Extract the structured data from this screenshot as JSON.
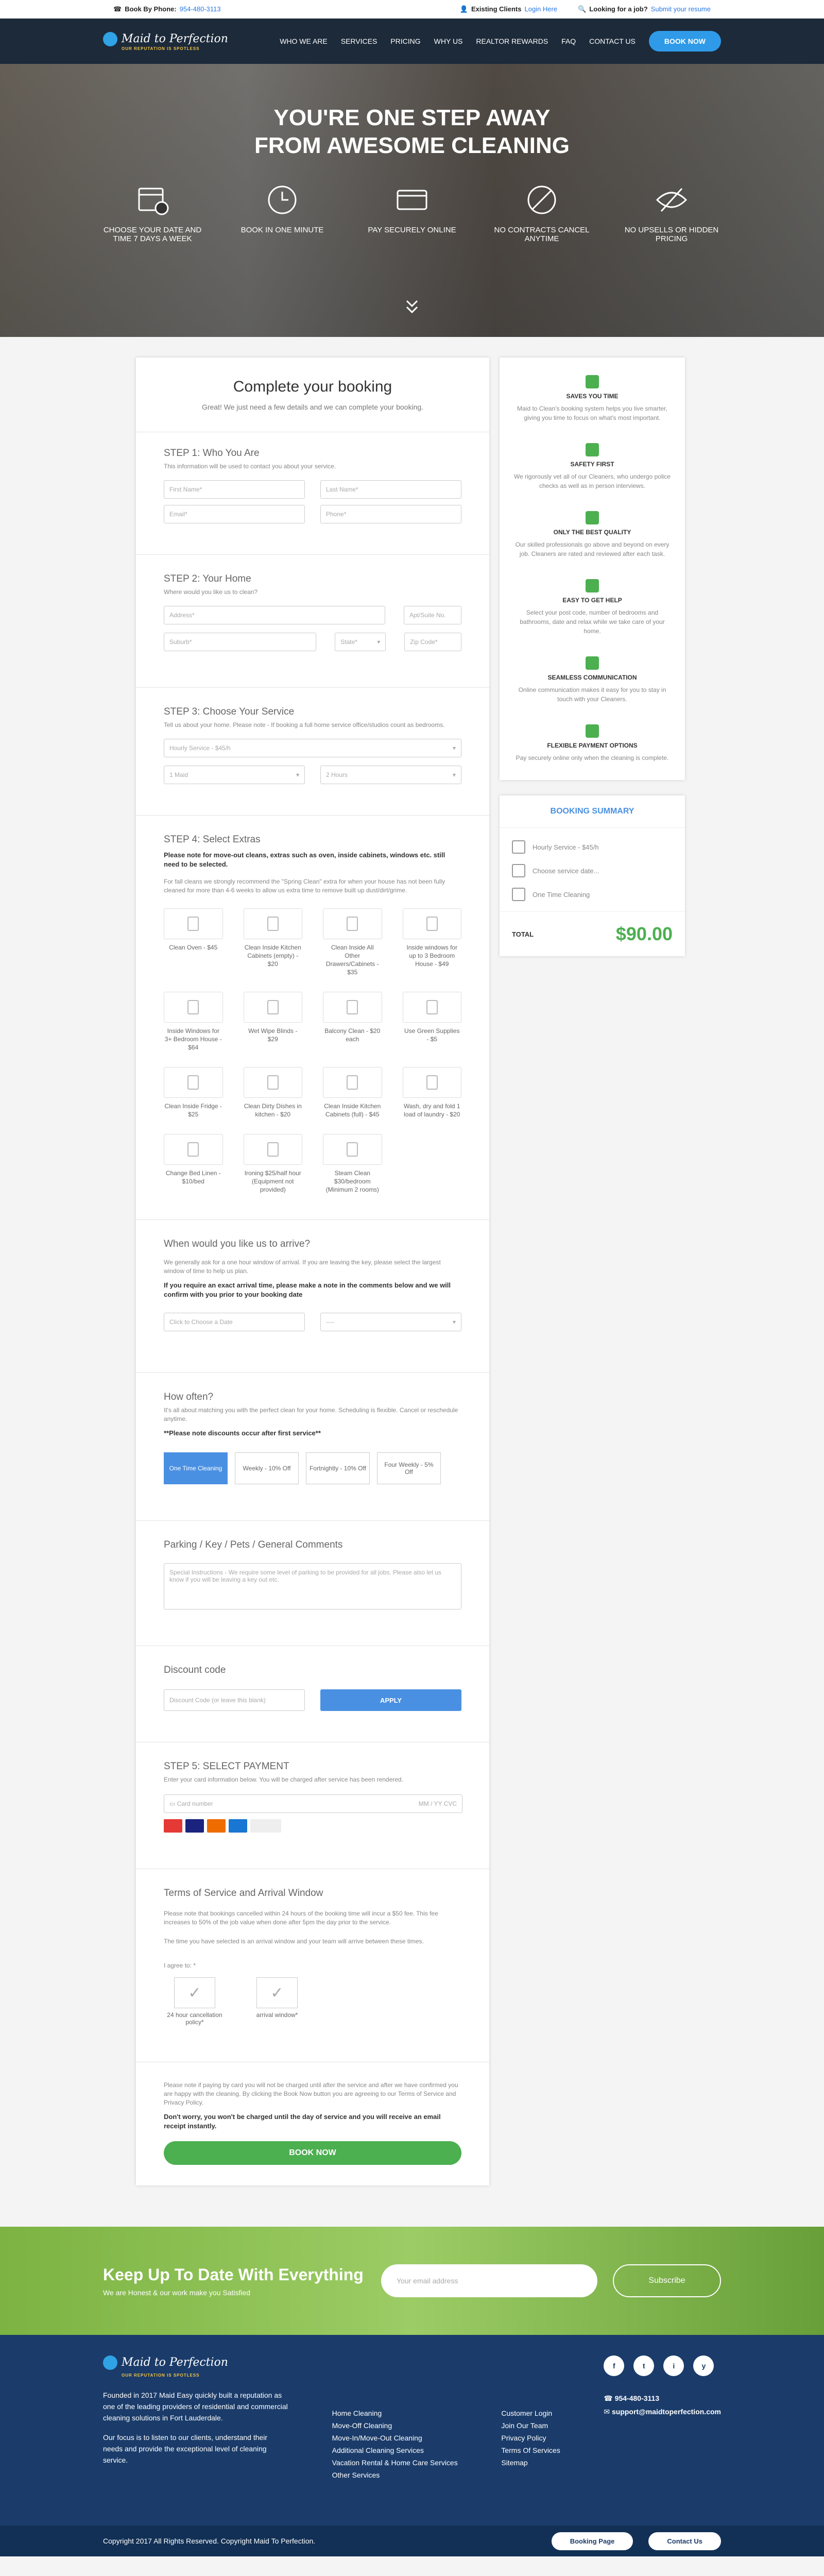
{
  "topbar": {
    "phone_label": "Book By Phone:",
    "phone": "954-480-3113",
    "existing": "Existing Clients",
    "login": "Login Here",
    "job": "Looking for a job?",
    "apply": "Submit your resume"
  },
  "nav": {
    "logo": "Maid to Perfection",
    "tagline": "OUR REPUTATION IS SPOTLESS",
    "items": [
      "WHO WE ARE",
      "SERVICES",
      "PRICING",
      "WHY US",
      "REALTOR REWARDS",
      "FAQ",
      "CONTACT US"
    ],
    "book": "BOOK NOW"
  },
  "hero": {
    "title1": "YOU'RE ONE STEP AWAY",
    "title2": "FROM AWESOME CLEANING",
    "features": [
      "CHOOSE YOUR DATE AND TIME 7 DAYS A WEEK",
      "BOOK IN ONE MINUTE",
      "PAY SECURELY ONLINE",
      "NO CONTRACTS CANCEL ANYTIME",
      "NO UPSELLS OR HIDDEN PRICING"
    ]
  },
  "booking": {
    "title": "Complete your booking",
    "subtitle": "Great! We just need a few details and we can complete your booking.",
    "step1": {
      "title": "STEP 1: Who You Are",
      "note": "This information will be used to contact you about your service.",
      "first": "First Name*",
      "last": "Last Name*",
      "email": "Email*",
      "phone": "Phone*"
    },
    "step2": {
      "title": "STEP 2: Your Home",
      "note": "Where would you like us to clean?",
      "address": "Address*",
      "suite": "Apt/Suite No.",
      "suburb": "Suburb*",
      "state": "State*",
      "zip": "Zip Code*"
    },
    "step3": {
      "title": "STEP 3: Choose Your Service",
      "note": "Tell us about your home. Please note - If booking a full home service office/studios count as bedrooms.",
      "service": "Hourly Service - $45/h",
      "maid": "1 Maid",
      "hours": "2 Hours"
    },
    "step4": {
      "title": "STEP 4: Select Extras",
      "bold": "Please note for move-out cleans, extras such as oven, inside cabinets, windows etc. still need to be selected.",
      "note": "For fall cleans we strongly recommend the \"Spring Clean\" extra for when your house has not been fully cleaned for more than 4-6 weeks to allow us extra time to remove built up dust/dirt/grime.",
      "extras": [
        "Clean Oven - $45",
        "Clean Inside Kitchen Cabinets (empty) - $20",
        "Clean Inside All Other Drawers/Cabinets - $35",
        "Inside windows for up to 3 Bedroom House - $49",
        "Inside Windows for 3+ Bedroom House - $64",
        "Wet Wipe Blinds - $29",
        "Balcony Clean - $20 each",
        "Use Green Supplies - $5",
        "Clean Inside Fridge - $25",
        "Clean Dirty Dishes in kitchen - $20",
        "Clean Inside Kitchen Cabinets (full) - $45",
        "Wash, dry and fold 1 load of laundry - $20",
        "Change Bed Linen - $10/bed",
        "Ironing $25/half hour (Equipment not provided)",
        "Steam Clean $30/bedroom (Minimum 2 rooms)"
      ]
    },
    "arrive": {
      "title": "When would you like us to arrive?",
      "note": "We generally ask for a one hour window of arrival. If you are leaving the key, please select the largest window of time to help us plan.",
      "bold": "If you require an exact arrival time, please make a note in the comments below and we will confirm with you prior to your booking date",
      "date": "Click to Choose a Date",
      "time": "----"
    },
    "often": {
      "title": "How often?",
      "note": "It's all about matching you with the perfect clean for your home. Scheduling is flexible. Cancel or reschedule anytime.",
      "bold": "**Please note discounts occur after first service**",
      "options": [
        "One Time Cleaning",
        "Weekly - 10% Off",
        "Fortnightly - 10% Off",
        "Four Weekly - 5% Off"
      ]
    },
    "comments": {
      "title": "Parking / Key / Pets / General Comments",
      "placeholder": "Special Instructions - We require some level of parking to be provided for all jobs. Please also let us know if you will be leaving a key out etc."
    },
    "discount": {
      "title": "Discount code",
      "placeholder": "Discount Code (or leave this blank)",
      "apply": "APPLY"
    },
    "step5": {
      "title": "STEP 5: SELECT PAYMENT",
      "note": "Enter your card information below. You will be charged after service has been rendered.",
      "card": "Card number",
      "exp": "MM / YY  CVC"
    },
    "terms": {
      "title": "Terms of Service and Arrival Window",
      "p1": "Please note that bookings cancelled within 24 hours of the booking time will incur a $50 fee. This fee increases to 50% of the job value when done after 5pm the day prior to the service.",
      "p2": "The time you have selected is an arrival window and your team will arrive between these times.",
      "agree": "I agree to: *",
      "c1": "24 hour cancellation policy*",
      "c2": "arrival window*"
    },
    "final": {
      "p": "Please note if paying by card you will not be charged until after the service and after we have confirmed you are happy with the cleaning. By clicking the Book Now button you are agreeing to our Terms of Service and Privacy Policy.",
      "bold": "Don't worry, you won't be charged until the day of service and you will receive an email receipt instantly.",
      "button": "BOOK NOW"
    }
  },
  "why": [
    {
      "t": "SAVES YOU TIME",
      "d": "Maid to Clean's booking system helps you live smarter, giving you time to focus on what's most important."
    },
    {
      "t": "SAFETY FIRST",
      "d": "We rigorously vet all of our Cleaners, who undergo police checks as well as in person interviews."
    },
    {
      "t": "ONLY THE BEST QUALITY",
      "d": "Our skilled professionals go above and beyond on every job. Cleaners are rated and reviewed after each task."
    },
    {
      "t": "EASY TO GET HELP",
      "d": "Select your post code, number of bedrooms and bathrooms, date and relax while we take care of your home."
    },
    {
      "t": "SEAMLESS COMMUNICATION",
      "d": "Online communication makes it easy for you to stay in touch with your Cleaners."
    },
    {
      "t": "FLEXIBLE PAYMENT OPTIONS",
      "d": "Pay securely online only when the cleaning is complete."
    }
  ],
  "summary": {
    "title": "BOOKING SUMMARY",
    "service": "Hourly Service - $45/h",
    "date": "Choose service date...",
    "freq": "One Time Cleaning",
    "total_label": "TOTAL",
    "total": "$90.00"
  },
  "news": {
    "title": "Keep Up To Date With Everything",
    "sub": "We are Honest & our work make you Satisfied",
    "email": "Your email address",
    "subscribe": "Subscribe"
  },
  "footer": {
    "about": "Founded in 2017 Maid Easy quickly built a reputation as one of the leading providers of residential and commercial cleaning solutions in Fort Lauderdale.",
    "focus": "Our focus is to listen to our clients, understand their needs and provide the exceptional level of cleaning service.",
    "col2": [
      "Home Cleaning",
      "Move-Off Cleaning",
      "Move-In/Move-Out Cleaning",
      "Additional Cleaning Services",
      "Vacation Rental & Home Care Services",
      "Other Services"
    ],
    "col3": [
      "Customer Login",
      "Join Our Team",
      "Privacy Policy",
      "Terms Of Services",
      "Sitemap"
    ],
    "social": [
      "f",
      "t",
      "i",
      "y"
    ],
    "phone": "954-480-3113",
    "email": "support@maidtoperfection.com"
  },
  "copy": {
    "text": "Copyright 2017 All Rights Reserved. Copyright Maid To Perfection.",
    "b1": "Booking Page",
    "b2": "Contact Us"
  }
}
